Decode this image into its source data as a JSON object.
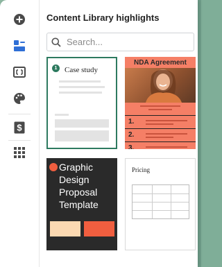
{
  "panel": {
    "title": "Content Library highlights"
  },
  "search": {
    "placeholder": "Search..."
  },
  "rail": {
    "items": [
      {
        "icon": "plus-circle-icon"
      },
      {
        "icon": "content-library-icon",
        "active": true
      },
      {
        "icon": "frame-icon"
      },
      {
        "icon": "palette-icon"
      },
      {
        "icon": "dollar-icon"
      },
      {
        "icon": "grid-apps-icon"
      }
    ]
  },
  "cards": [
    {
      "name": "case-study-card",
      "badge": "1",
      "title": "Case study",
      "selected": true
    },
    {
      "name": "nda-agreement-card",
      "title": "NDA Agreement",
      "rows": [
        "1.",
        "2.",
        "3."
      ]
    },
    {
      "name": "graphic-design-proposal-card",
      "title": "Graphic Design Proposal Template"
    },
    {
      "name": "pricing-card",
      "title": "Pricing"
    }
  ],
  "colors": {
    "accent": "#2d7a5f",
    "coral": "#f57f66",
    "dark": "#2a2a2a",
    "orange": "#f05e3f",
    "peach": "#fbd9b2"
  }
}
